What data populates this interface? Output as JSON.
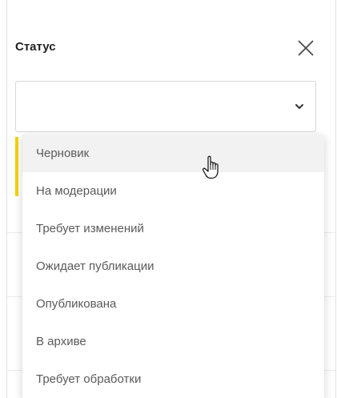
{
  "filter_panel": {
    "title": "Статус",
    "close_icon": "close-icon",
    "select": {
      "value": "",
      "chevron_icon": "chevron-down-icon"
    },
    "accent_color": "#f5d000"
  },
  "dropdown": {
    "hovered_index": 0,
    "options": [
      {
        "label": "Черновик"
      },
      {
        "label": "На модерации"
      },
      {
        "label": "Требует изменений"
      },
      {
        "label": "Ожидает публикации"
      },
      {
        "label": "Опубликована"
      },
      {
        "label": "В архиве"
      },
      {
        "label": "Требует обработки"
      }
    ]
  },
  "cursor": {
    "icon": "hand-pointer-cursor-icon"
  }
}
